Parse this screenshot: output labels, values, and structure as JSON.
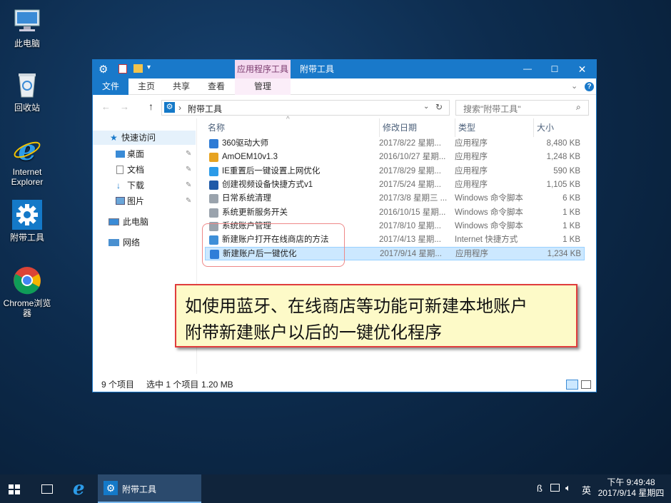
{
  "desktop": {
    "icons": [
      {
        "label": "此电脑"
      },
      {
        "label": "回收站"
      },
      {
        "label": "Internet Explorer"
      },
      {
        "label": "附带工具"
      },
      {
        "label": "Chrome浏览器"
      }
    ]
  },
  "window": {
    "context_tab": "应用程序工具",
    "title": "附带工具",
    "tabs": {
      "file": "文件",
      "home": "主页",
      "share": "共享",
      "view": "查看",
      "manage": "管理"
    },
    "address_path": "附带工具",
    "search_placeholder": "搜索\"附带工具\"",
    "nav": {
      "quick_access": "快速访问",
      "items": [
        {
          "label": "桌面"
        },
        {
          "label": "文档"
        },
        {
          "label": "下载"
        },
        {
          "label": "图片"
        }
      ],
      "this_pc": "此电脑",
      "network": "网络"
    },
    "columns": {
      "name": "名称",
      "date": "修改日期",
      "type": "类型",
      "size": "大小"
    },
    "files": [
      {
        "name": "360驱动大师",
        "date": "2017/8/22 星期...",
        "type": "应用程序",
        "size": "8,480 KB"
      },
      {
        "name": "AmOEM10v1.3",
        "date": "2016/10/27 星期...",
        "type": "应用程序",
        "size": "1,248 KB"
      },
      {
        "name": "IE重置后一键设置上网优化",
        "date": "2017/8/29 星期...",
        "type": "应用程序",
        "size": "590 KB"
      },
      {
        "name": "创建视频设备快捷方式v1",
        "date": "2017/5/24 星期...",
        "type": "应用程序",
        "size": "1,105 KB"
      },
      {
        "name": "日常系统清理",
        "date": "2017/3/8 星期三 ...",
        "type": "Windows 命令脚本",
        "size": "6 KB"
      },
      {
        "name": "系统更新服务开关",
        "date": "2016/10/15 星期...",
        "type": "Windows 命令脚本",
        "size": "1 KB"
      },
      {
        "name": "系统账户管理",
        "date": "2017/8/10 星期...",
        "type": "Windows 命令脚本",
        "size": "1 KB"
      },
      {
        "name": "新建账户打开在线商店的方法",
        "date": "2017/4/13 星期...",
        "type": "Internet 快捷方式",
        "size": "1 KB"
      },
      {
        "name": "新建账户后一键优化",
        "date": "2017/9/14 星期...",
        "type": "应用程序",
        "size": "1,234 KB"
      }
    ],
    "status": {
      "count": "9 个项目",
      "selected": "选中 1 个项目",
      "size": "1.20 MB"
    }
  },
  "callout": {
    "line1": "如使用蓝牙、在线商店等功能可新建本地账户",
    "line2": "附带新建账户以后的一键优化程序"
  },
  "taskbar": {
    "active_app": "附带工具",
    "ime": "英",
    "time": "下午 9:49:48",
    "date": "2017/9/14 星期四"
  },
  "colors": {
    "accent": "#1979ca",
    "selection": "#cce8ff",
    "callout_bg": "#fdfac8",
    "callout_border": "#e03c3c"
  }
}
